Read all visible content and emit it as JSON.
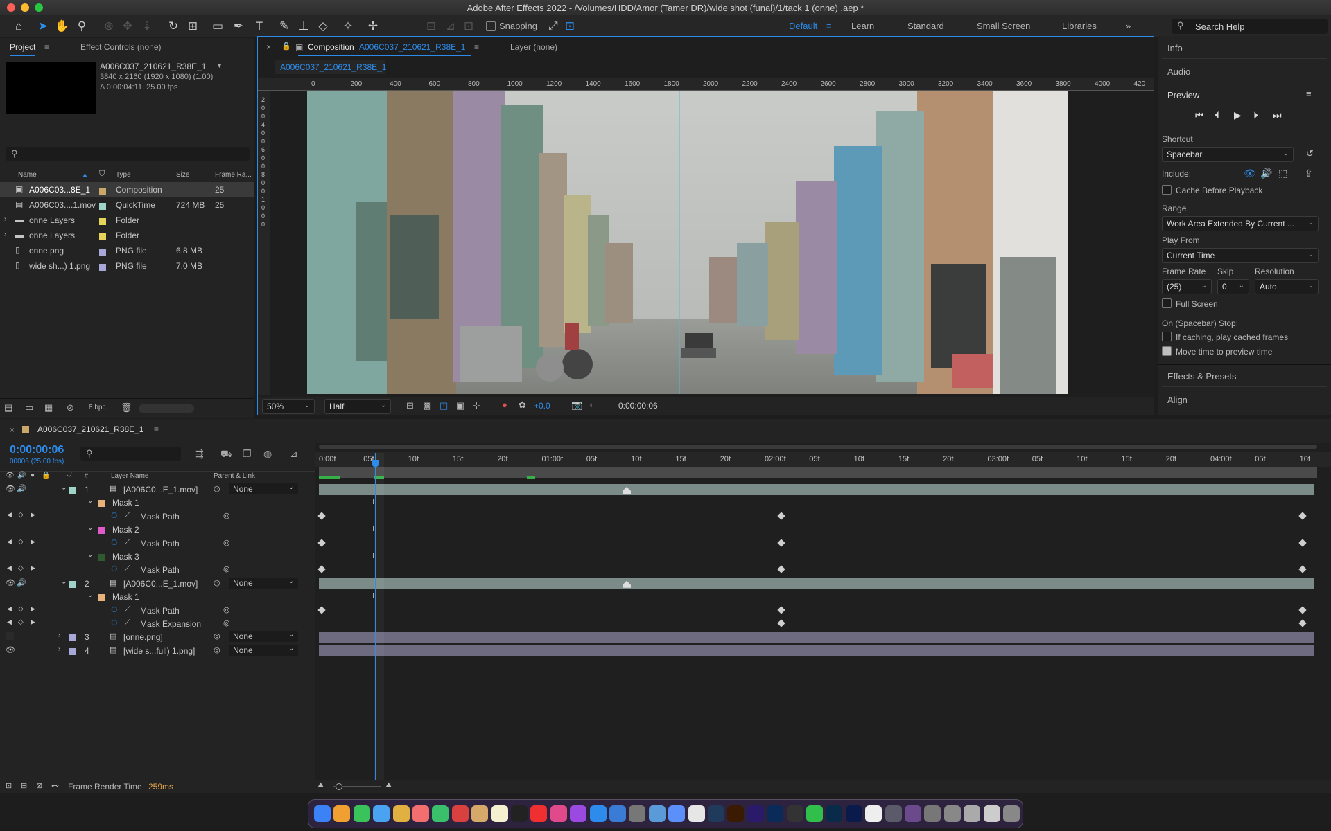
{
  "window": {
    "title": "Adobe After Effects 2022 - /Volumes/HDD/Amor (Tamer DR)/wide shot (funal)/1/tack 1 (onne) .aep *"
  },
  "toolbar": {
    "snapping": "Snapping",
    "workspaces": [
      "Default",
      "Learn",
      "Standard",
      "Small Screen",
      "Libraries"
    ],
    "active_workspace": "Default",
    "search_placeholder": "Search Help"
  },
  "project": {
    "tab": "Project",
    "effect_tab": "Effect Controls (none)",
    "item_name": "A006C037_210621_R38E_1",
    "item_res": "3840 x 2160  (1920 x 1080) (1.00)",
    "item_dur": "Δ 0:00:04:11, 25.00 fps",
    "search_placeholder": "⚲",
    "columns": [
      "Name",
      "Type",
      "Size",
      "Frame Ra..."
    ],
    "items": [
      {
        "name": "A006C03...8E_1",
        "type": "Composition",
        "size": "",
        "fps": "25",
        "color": "#c9a86a",
        "icon": "composition-icon"
      },
      {
        "name": "A006C03....1.mov",
        "type": "QuickTime",
        "size": "724 MB",
        "fps": "25",
        "color": "#9fd3c7",
        "icon": "footage-icon"
      },
      {
        "name": "onne Layers",
        "type": "Folder",
        "size": "",
        "fps": "",
        "color": "#e6d35a",
        "icon": "folder-icon"
      },
      {
        "name": "onne Layers",
        "type": "Folder",
        "size": "",
        "fps": "",
        "color": "#e6d35a",
        "icon": "folder-icon"
      },
      {
        "name": "onne.png",
        "type": "PNG file",
        "size": "6.8 MB",
        "fps": "",
        "color": "#a8a8d8",
        "icon": "image-file-icon"
      },
      {
        "name": "wide sh...) 1.png",
        "type": "PNG file",
        "size": "7.0 MB",
        "fps": "",
        "color": "#a8a8d8",
        "icon": "image-file-icon"
      }
    ],
    "bpc": "8 bpc"
  },
  "composition": {
    "tab_prefix": "Composition",
    "tab_name": "A006C037_210621_R38E_1",
    "layer_tab": "Layer (none)",
    "subtab": "A006C037_210621_R38E_1",
    "ruler": [
      "0",
      "200",
      "400",
      "600",
      "800",
      "1000",
      "1200",
      "1400",
      "1600",
      "1800",
      "2000",
      "2200",
      "2400",
      "2600",
      "2800",
      "3000",
      "3200",
      "3400",
      "3600",
      "3800",
      "4000",
      "420"
    ],
    "vruler": [
      "2",
      "0",
      "0",
      "4",
      "0",
      "0",
      "6",
      "0",
      "0",
      "8",
      "0",
      "0",
      "1",
      "0",
      "0",
      "0"
    ],
    "zoom": "50%",
    "resolution": "Half",
    "exposure": "+0.0",
    "timecode": "0:00:00:06"
  },
  "right_panel": {
    "info": "Info",
    "audio": "Audio",
    "preview": "Preview",
    "shortcut_label": "Shortcut",
    "shortcut_value": "Spacebar",
    "include_label": "Include:",
    "cache_before": "Cache Before Playback",
    "range_label": "Range",
    "range_value": "Work Area Extended By Current ...",
    "play_from_label": "Play From",
    "play_from_value": "Current Time",
    "frame_rate_label": "Frame Rate",
    "skip_label": "Skip",
    "resolution_label": "Resolution",
    "frame_rate_value": "(25)",
    "skip_value": "0",
    "resolution_value": "Auto",
    "full_screen": "Full Screen",
    "on_stop": "On (Spacebar) Stop:",
    "if_caching": "If caching, play cached frames",
    "move_time": "Move time to preview time",
    "effects": "Effects & Presets",
    "align": "Align"
  },
  "timeline": {
    "comp_tab": "A006C037_210621_R38E_1",
    "timecode": "0:00:00:06",
    "frames": "00006 (25.00 fps)",
    "col_layer": "Layer Name",
    "col_parent": "Parent & Link",
    "col_num": "#",
    "ruler": [
      "0:00f",
      "05f",
      "10f",
      "15f",
      "20f",
      "01:00f",
      "05f",
      "10f",
      "15f",
      "20f",
      "02:00f",
      "05f",
      "10f",
      "15f",
      "20f",
      "03:00f",
      "05f",
      "10f",
      "15f",
      "20f",
      "04:00f",
      "05f",
      "10f"
    ],
    "layers": [
      {
        "kind": "layer",
        "num": "1",
        "name": "[A006C0...E_1.mov]",
        "parent": "None",
        "color": "#9fd3c7",
        "indent": 0
      },
      {
        "kind": "mask",
        "name": "Mask 1",
        "color": "#e8b07a",
        "indent": 1
      },
      {
        "kind": "prop",
        "name": "Mask Path",
        "indent": 2
      },
      {
        "kind": "mask",
        "name": "Mask 2",
        "color": "#e05acb",
        "indent": 1
      },
      {
        "kind": "prop",
        "name": "Mask Path",
        "indent": 2
      },
      {
        "kind": "mask",
        "name": "Mask 3",
        "color": "#2f5a2f",
        "indent": 1
      },
      {
        "kind": "prop",
        "name": "Mask Path",
        "indent": 2
      },
      {
        "kind": "layer",
        "num": "2",
        "name": "[A006C0...E_1.mov]",
        "parent": "None",
        "color": "#9fd3c7",
        "indent": 0
      },
      {
        "kind": "mask",
        "name": "Mask 1",
        "color": "#e8b07a",
        "indent": 1
      },
      {
        "kind": "prop",
        "name": "Mask Path",
        "indent": 2
      },
      {
        "kind": "prop",
        "name": "Mask Expansion",
        "indent": 2
      },
      {
        "kind": "layer",
        "num": "3",
        "name": "[onne.png]",
        "parent": "None",
        "color": "#a8a8d8",
        "indent": 0
      },
      {
        "kind": "layer",
        "num": "4",
        "name": "[wide s...full) 1.png]",
        "parent": "None",
        "color": "#a8a8d8",
        "indent": 0
      }
    ],
    "render_label": "Frame Render Time",
    "render_value": "259ms"
  },
  "colors": {
    "accent": "#2d8ceb",
    "layer_bar": "#7b8c88",
    "png_bar": "#6e6a80"
  }
}
